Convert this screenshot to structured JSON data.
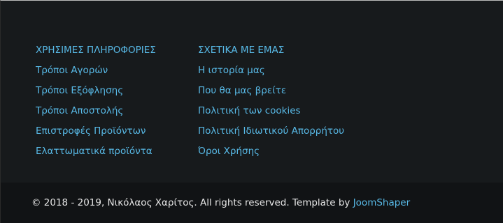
{
  "footer": {
    "columns": [
      {
        "heading": "ΧΡΗΣΙΜΕΣ ΠΛΗΡΟΦΟΡΙΕΣ",
        "links": [
          "Τρόποι Αγορών",
          "Τρόποι Εξόφλησης",
          "Τρόποι Αποστολής",
          "Επιστροφές Προϊόντων",
          "Ελαττωματικά προϊόντα"
        ]
      },
      {
        "heading": "ΣΧΕΤΙΚΑ ΜΕ ΕΜΑΣ",
        "links": [
          "Η ιστορία μας",
          "Που θα μας βρείτε",
          "Πολιτική των cookies",
          "Πολιτική Ιδιωτικού Απορρήτου",
          "Όροι Χρήσης"
        ]
      }
    ],
    "copyright_text": "© 2018 - 2019, Νικόλαος Χαρίτος. All rights reserved. Template by ",
    "template_author": "JoomShaper"
  },
  "colors": {
    "background": "#171a1c",
    "bottom_bar": "#111315",
    "link": "#58b9e6",
    "text": "#e6e6e6"
  }
}
